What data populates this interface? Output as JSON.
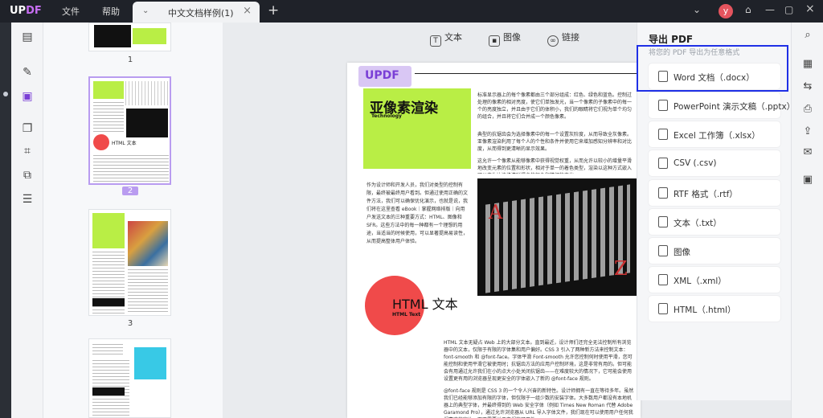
{
  "app": {
    "logo_a": "UP",
    "logo_b": "DF"
  },
  "menu": {
    "file": "文件",
    "help": "帮助"
  },
  "tab": {
    "title": "中文文档样例(1)"
  },
  "user": {
    "initial": "y"
  },
  "thumbs": {
    "page_numbers": [
      "1",
      "2",
      "3"
    ]
  },
  "content_toolbar": {
    "text": "文本",
    "image": "图像",
    "link": "链接"
  },
  "document": {
    "brand": "UPDF",
    "heading": "亚像素渲染",
    "heading_sub": "Technology",
    "circle_title": "HTML 文本",
    "circle_sub": "HTML Text",
    "para_right": "标准显示器上的每个像素都由三个部分组成：红色、绿色和蓝色。控制过处理的像素的相对亮度，使它们单独发光，当一个像素的子像素中的每一个的亮度独立，并且由于它们的体积小，我们的眼睛将它们视为单个均匀的组合，并且将它们合并成一个颜色像素。",
    "para_right2": "典型的抗锯齿会为选择像素中的每一个设置灰阶度，从而导致全灰像素。亚像素渲染利用了每个人的个性和条件并使用它来增加感知分辨率和对比度，从而得到更清晰的显示效果。",
    "para_right3": "这允许一个像素从能够像素中获得视觉权重，从而允许以较小的增量平滑地改变元素的位置和形状，相对于单一的着色类型，渲染以这种方式嵌入可以产生比边缘清晰得多的颜色和精细的变化。",
    "para_left": "作为设计师和开发人员，我们对类型的控制有限，最终被最终用户看到。但通过使用正确的文件方法，我们可以确保优化演示，也就是说，我们将在这里查看 eBook｜掌握网络排版｜向用户发送文本的三种重要方式：HTML、图像和SFR。这些方法中的每一种都有一个理想的用途，当适当的时候使用，可以显著提高易读性，从而提高整体用户体验。",
    "para_bottom": "HTML 文本无疑占 Web 上的大部分文本。直到最近，设计师们还完全无法控制所有浏览器中的文本，仅限于有限的字体集和用户偏好。CSS 3 引入了两种新方法来控制文本：font-smooth 和 @font-face。字体平滑 Font-smooth 允许您控制何时使用平滑，您可能控制和使用平滑它被使用时；抗锯齿方法的应用户控制环境，这是非常有用的。但可能会有用通过允许我们在小的点大小处关闭抗锯齿——在难度较大的情况下，它可能会使用设置更有用的浏览器呈现更安全的字体嵌入了新的 @font-face 规则。",
    "para_bottom2": "@font-face 规则是 CSS 3 的一个令人兴奋的新特性。设计师拥有一直在等待多年。虽然我们已经能够添加有限的字体，但仅限于一组少数的安装字体。大多数用户都没有本地机器上的典型字体，并最终得到的 Web 安全字体（例如 Times New Roman 代替 Adobe Garamond Pro），通过允许浏览器从 URL 导入字体文件，我们现在可以使用用户任何我们喜欢的字体，而不需要关于它们的可用性。"
  },
  "export_panel": {
    "title": "导出 PDF",
    "subtitle": "将您的 PDF 导出为任意格式",
    "options": [
      "Word 文档（.docx）",
      "PowerPoint 演示文稿（.pptx）",
      "Excel 工作簿（.xlsx）",
      "CSV (.csv)",
      "RTF 格式（.rtf）",
      "文本（.txt）",
      "图像",
      "XML（.xml）",
      "HTML（.html）"
    ]
  },
  "colors": {
    "accent": "#7a3fd6",
    "highlight_box": "#1f30e6",
    "lime": "#b9ee45",
    "red_circle": "#f04a4a"
  }
}
